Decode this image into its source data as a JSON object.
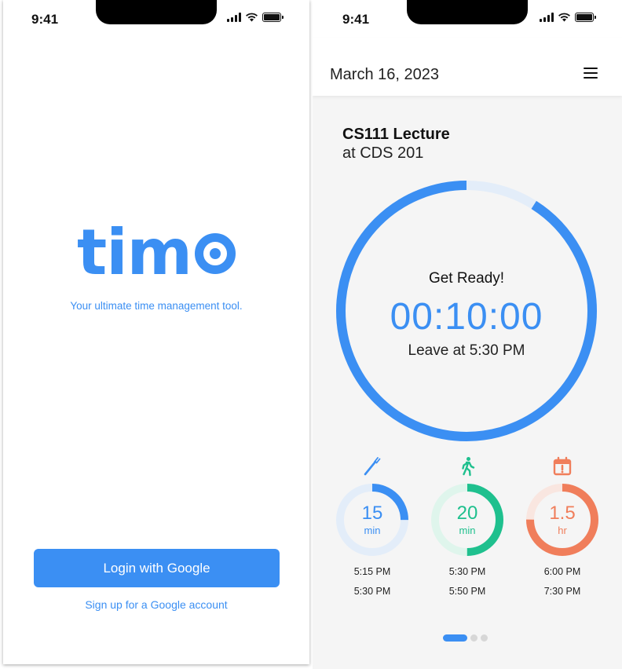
{
  "login_screen": {
    "status_time": "9:41",
    "logo": {
      "text_prefix": "tim",
      "text_suffix": "o"
    },
    "tagline": "Your ultimate time management tool.",
    "login_button": "Login with Google",
    "signup_link": "Sign up for a Google account"
  },
  "timer_screen": {
    "status_time": "9:41",
    "header": {
      "date": "March 16, 2023",
      "menu_icon": "hamburger-menu-icon"
    },
    "event": {
      "title": "CS111 Lecture",
      "location": "at CDS 201"
    },
    "main_timer": {
      "status": "Get Ready!",
      "countdown": "00:10:00",
      "leave_text": "Leave at 5:30 PM",
      "progress": 0.91,
      "color": "#3b8ff3",
      "track_color": "#e3edf9"
    },
    "sub_timers": [
      {
        "icon": "toothbrush-icon",
        "value": "15",
        "unit": "min",
        "start": "5:15 PM",
        "end": "5:30 PM",
        "progress": 0.25,
        "color": "#3b8ff3",
        "track_color": "#e3edf9"
      },
      {
        "icon": "walking-person-icon",
        "value": "20",
        "unit": "min",
        "start": "5:30 PM",
        "end": "5:50 PM",
        "progress": 0.5,
        "color": "#1fc08e",
        "track_color": "#dff5ec"
      },
      {
        "icon": "calendar-alert-icon",
        "value": "1.5",
        "unit": "hr",
        "start": "6:00 PM",
        "end": "7:30 PM",
        "progress": 0.75,
        "color": "#f07e5b",
        "track_color": "#f9e6e0"
      }
    ],
    "page_indicator": {
      "total": 3,
      "active": 1
    }
  }
}
